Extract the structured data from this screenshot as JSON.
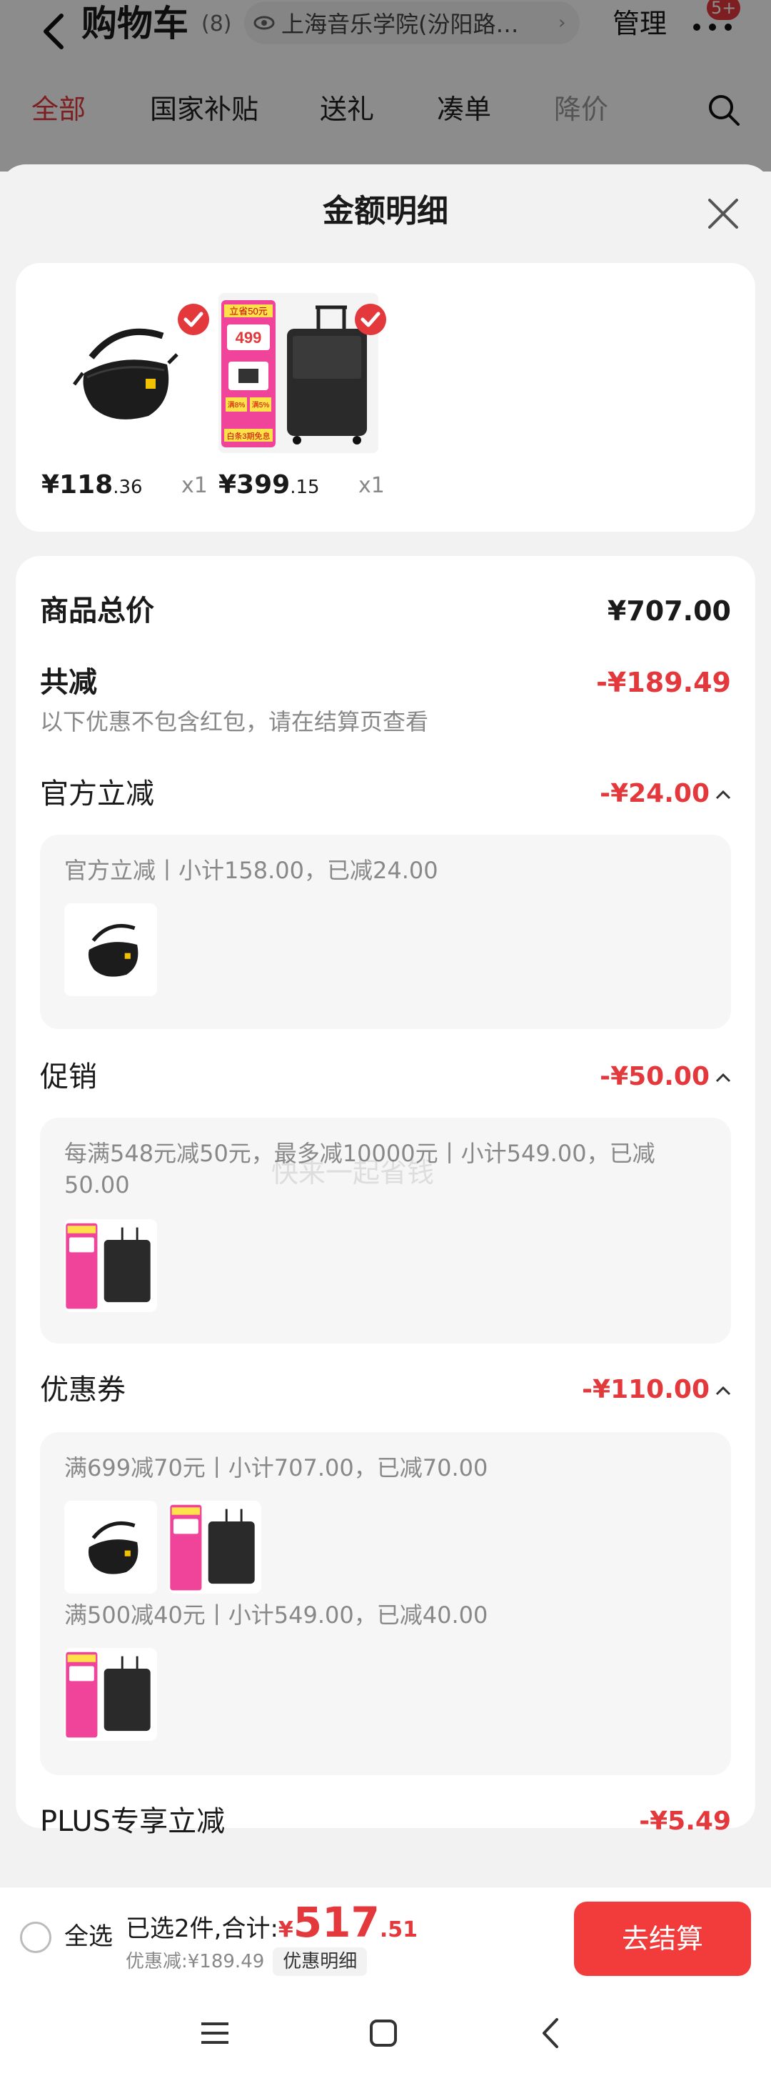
{
  "header": {
    "title": "购物车",
    "count": "(8)",
    "address": "上海音乐学院(汾阳路…",
    "manage_label": "管理",
    "more_badge": "5+"
  },
  "tabs": [
    {
      "label": "全部",
      "active": true
    },
    {
      "label": "国家补贴"
    },
    {
      "label": "送礼"
    },
    {
      "label": "凑单"
    },
    {
      "label": "降价"
    }
  ],
  "sheet": {
    "title": "金额明细",
    "products": [
      {
        "name": "black-sling-bag",
        "price_int": "¥118",
        "price_dec": ".36",
        "qty": "x1",
        "checked": true
      },
      {
        "name": "suitcase",
        "price_int": "¥399",
        "price_dec": ".15",
        "qty": "x1",
        "checked": true
      }
    ],
    "suitcase_promo": {
      "top": "立省50元",
      "mid": "499",
      "bottom": "白条3期免息",
      "chip1": "满8%",
      "chip2": "满5%"
    },
    "goods_total": {
      "label": "商品总价",
      "value": "¥707.00"
    },
    "total_discount": {
      "label": "共减",
      "value": "-¥189.49",
      "note": "以下优惠不包含红包，请在结算页查看"
    },
    "official": {
      "label": "官方立减",
      "value": "-¥24.00",
      "detail": "官方立减丨小计158.00，已减24.00"
    },
    "promo": {
      "label": "促销",
      "value": "-¥50.00",
      "detail": "每满548元减50元，最多减10000元丨小计549.00，已减50.00"
    },
    "coupon": {
      "label": "优惠券",
      "value": "-¥110.00",
      "detail1": "满699减70元丨小计707.00，已减70.00",
      "detail2": "满500减40元丨小计549.00，已减40.00"
    },
    "plus": {
      "label": "PLUS专享立减",
      "value": "-¥5.49"
    },
    "watermark": "快来一起省钱"
  },
  "bottom": {
    "select_all": "全选",
    "summary_prefix": "已选2件,合计:",
    "total_currency": "¥",
    "total_int": "517",
    "total_dec": ".51",
    "discount_text": "优惠减:¥189.49",
    "detail_chip": "优惠明细",
    "checkout_label": "去结算"
  },
  "colors": {
    "accent": "#e4393c",
    "checkout": "#f23b3b",
    "promo_pink": "#f0449a",
    "promo_yellow": "#ffe14a"
  }
}
